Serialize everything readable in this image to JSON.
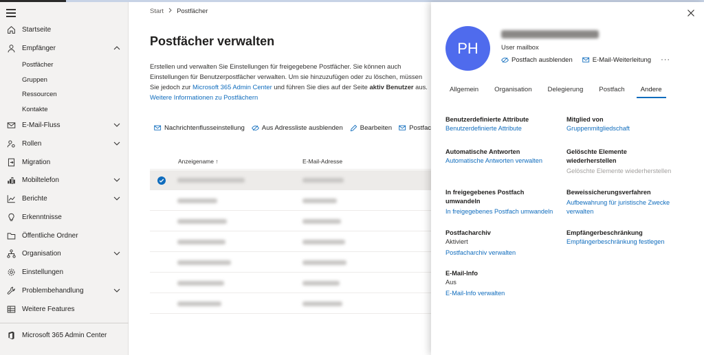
{
  "sidebar": {
    "items": [
      {
        "label": "Startseite"
      },
      {
        "label": "Empfänger"
      },
      {
        "label": "E-Mail-Fluss"
      },
      {
        "label": "Rollen"
      },
      {
        "label": "Migration"
      },
      {
        "label": "Mobiltelefon"
      },
      {
        "label": "Berichte"
      },
      {
        "label": "Erkenntnisse"
      },
      {
        "label": "Öffentliche Ordner"
      },
      {
        "label": "Organisation"
      },
      {
        "label": "Einstellungen"
      },
      {
        "label": "Problembehandlung"
      },
      {
        "label": "Weitere Features"
      }
    ],
    "sub_items": [
      {
        "label": "Postfächer"
      },
      {
        "label": "Gruppen"
      },
      {
        "label": "Ressourcen"
      },
      {
        "label": "Kontakte"
      }
    ],
    "footer": {
      "label": "Microsoft 365 Admin Center"
    }
  },
  "breadcrumb": {
    "root": "Start",
    "current": "Postfächer"
  },
  "main": {
    "title": "Postfächer verwalten",
    "desc_part1": "Erstellen und verwalten Sie Einstellungen für freigegebene Postfächer. Sie können auch Einstellungen für Benutzerpostfächer verwalten. Um sie hinzuzufügen oder zu löschen, müssen Sie jedoch zur ",
    "desc_link": "Microsoft 365 Admin Center",
    "desc_part2": " und führen Sie dies auf der Seite ",
    "desc_bold": "aktiv Benutzer",
    "desc_part3": " aus.",
    "desc_link2": "Weitere Informationen zu Postfächern",
    "toolbar": {
      "btn1": "Nachrichtenflusseinstellung",
      "btn2": "Aus Adressliste ausblenden",
      "btn3": "Bearbeiten",
      "btn4": "Postfachs"
    },
    "table": {
      "col1": "Anzeigename",
      "col1_sort": "↑",
      "col2": "E-Mail-Adresse"
    }
  },
  "panel": {
    "initials": "PH",
    "user_type": "User mailbox",
    "action1": "Postfach ausblenden",
    "action2": "E-Mail-Weiterleitung",
    "more": "···",
    "tabs": [
      {
        "label": "Allgemein"
      },
      {
        "label": "Organisation"
      },
      {
        "label": "Delegierung"
      },
      {
        "label": "Postfach"
      },
      {
        "label": "Andere"
      }
    ],
    "sections": {
      "custom_attr": {
        "heading": "Benutzerdefinierte Attribute",
        "link": "Benutzerdefinierte Attribute"
      },
      "member_of": {
        "heading": "Mitglied von",
        "link": "Gruppenmitgliedschaft"
      },
      "auto_reply": {
        "heading": "Automatische Antworten",
        "link": "Automatische Antworten verwalten"
      },
      "deleted": {
        "heading": "Gelöschte Elemente wiederherstellen",
        "link": "Gelöschte Elemente wiederherstellen"
      },
      "convert": {
        "heading": "In freigegebenes Postfach umwandeln",
        "link": "In freigegebenes Postfach umwandeln"
      },
      "litigation": {
        "heading": "Beweissicherungsverfahren",
        "link": "Aufbewahrung für juristische Zwecke verwalten"
      },
      "archive": {
        "heading": "Postfacharchiv",
        "value": "Aktiviert",
        "link": "Postfacharchiv verwalten"
      },
      "recipient_limit": {
        "heading": "Empfängerbeschränkung",
        "link": "Empfängerbeschränkung festlegen"
      },
      "mailtip": {
        "heading": "E-Mail-Info",
        "value": "Aus",
        "link": "E-Mail-Info verwalten"
      }
    }
  },
  "colors": {
    "accent": "#0f6cbd",
    "avatar": "#4f6bed"
  }
}
